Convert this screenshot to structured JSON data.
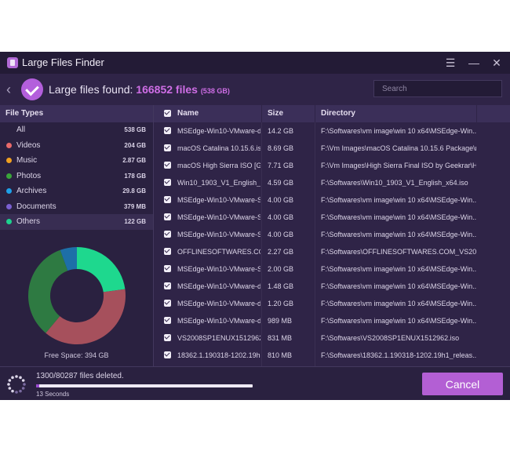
{
  "window": {
    "title": "Large Files Finder"
  },
  "header": {
    "found_label": "Large files found:",
    "found_count": "166852 files",
    "found_size": "(538 GB)",
    "search_placeholder": "Search"
  },
  "file_types": {
    "header": "File Types",
    "items": [
      {
        "label": "All",
        "size": "538 GB",
        "color": ""
      },
      {
        "label": "Videos",
        "size": "204 GB",
        "color": "#e86a6a"
      },
      {
        "label": "Music",
        "size": "2.87 GB",
        "color": "#f0a020"
      },
      {
        "label": "Photos",
        "size": "178 GB",
        "color": "#3aa53a"
      },
      {
        "label": "Archives",
        "size": "29.8 GB",
        "color": "#1ea0e8"
      },
      {
        "label": "Documents",
        "size": "379 MB",
        "color": "#7a5fd0"
      },
      {
        "label": "Others",
        "size": "122 GB",
        "color": "#1dd18e"
      }
    ],
    "chart_slices": [
      {
        "name": "Others",
        "value": 122,
        "color": "#1ed88e"
      },
      {
        "name": "Videos",
        "value": 204,
        "color": "#a6505c"
      },
      {
        "name": "Photos",
        "value": 178,
        "color": "#2e7a42"
      },
      {
        "name": "Archives",
        "value": 29.8,
        "color": "#1d6fa8"
      }
    ],
    "free_space": "Free Space: 394 GB"
  },
  "table": {
    "columns": {
      "name": "Name",
      "size": "Size",
      "directory": "Directory"
    },
    "rows": [
      {
        "name": "MSEdge-Win10-VMware-di",
        "size": "14.2 GB",
        "dir": "F:\\Softwares\\vm image\\win 10 x64\\MSEdge-Win..."
      },
      {
        "name": "macOS Catalina 10.15.6.iso",
        "size": "8.69 GB",
        "dir": "F:\\Vm Images\\macOS Catalina 10.15.6 Package\\m..."
      },
      {
        "name": "macOS High Sierra ISO [Geek",
        "size": "7.71 GB",
        "dir": "F:\\Vm Images\\High Sierra Final ISO by Geekrar\\Hig..."
      },
      {
        "name": "Win10_1903_V1_English_",
        "size": "4.59 GB",
        "dir": "F:\\Softwares\\Win10_1903_V1_English_x64.iso"
      },
      {
        "name": "MSEdge-Win10-VMware-Sr",
        "size": "4.00 GB",
        "dir": "F:\\Softwares\\vm image\\win 10 x64\\MSEdge-Win..."
      },
      {
        "name": "MSEdge-Win10-VMware-Sr",
        "size": "4.00 GB",
        "dir": "F:\\Softwares\\vm image\\win 10 x64\\MSEdge-Win..."
      },
      {
        "name": "MSEdge-Win10-VMware-Sr",
        "size": "4.00 GB",
        "dir": "F:\\Softwares\\vm image\\win 10 x64\\MSEdge-Win..."
      },
      {
        "name": "OFFLINESOFTWARES.COM_",
        "size": "2.27 GB",
        "dir": "F:\\Softwares\\OFFLINESOFTWARES.COM_VS2010..."
      },
      {
        "name": "MSEdge-Win10-VMware-Sr",
        "size": "2.00 GB",
        "dir": "F:\\Softwares\\vm image\\win 10 x64\\MSEdge-Win..."
      },
      {
        "name": "MSEdge-Win10-VMware-di",
        "size": "1.48 GB",
        "dir": "F:\\Softwares\\vm image\\win 10 x64\\MSEdge-Win..."
      },
      {
        "name": "MSEdge-Win10-VMware-di",
        "size": "1.20 GB",
        "dir": "F:\\Softwares\\vm image\\win 10 x64\\MSEdge-Win..."
      },
      {
        "name": "MSEdge-Win10-VMware-di",
        "size": "989 MB",
        "dir": "F:\\Softwares\\vm image\\win 10 x64\\MSEdge-Win..."
      },
      {
        "name": "VS2008SP1ENUX1512962.i",
        "size": "831 MB",
        "dir": "F:\\Softwares\\VS2008SP1ENUX1512962.iso"
      },
      {
        "name": "18362.1.190318-1202.19h",
        "size": "810 MB",
        "dir": "F:\\Softwares\\18362.1.190318-1202.19h1_releas..."
      }
    ]
  },
  "footer": {
    "deleted_text": "1300/80287 files deleted.",
    "progress": 0.016,
    "time": "13 Seconds",
    "cancel_label": "Cancel"
  }
}
